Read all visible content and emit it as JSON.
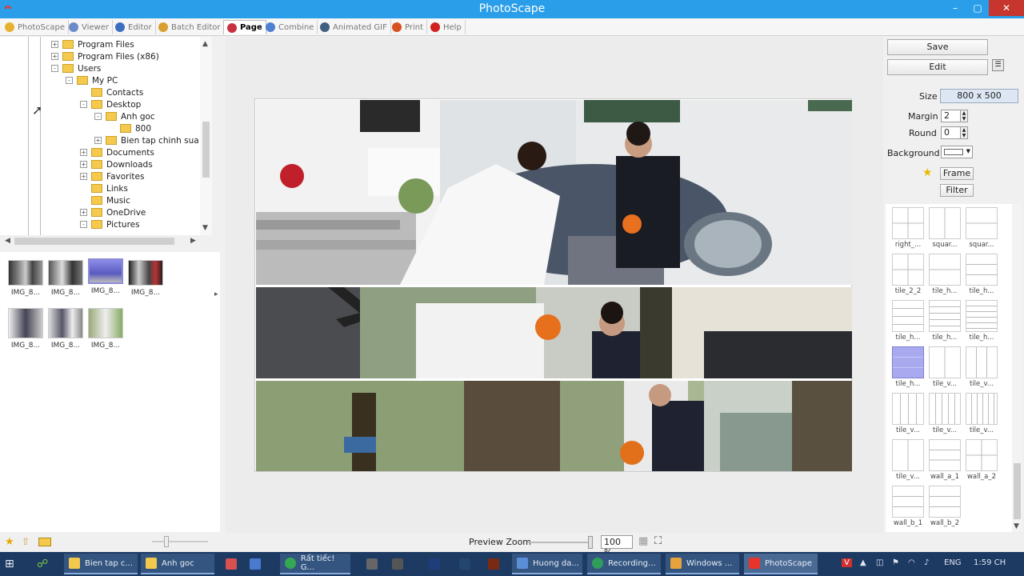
{
  "window": {
    "title": "PhotoScape",
    "minimize": "–",
    "maximize": "▢",
    "close": "✕"
  },
  "tabs": [
    {
      "label": "PhotoScape",
      "color": "#e8b030"
    },
    {
      "label": "Viewer",
      "color": "#6b8cc8"
    },
    {
      "label": "Editor",
      "color": "#3d6fc0"
    },
    {
      "label": "Batch Editor",
      "color": "#d8a030"
    },
    {
      "label": "Page",
      "color": "#c83040"
    },
    {
      "label": "Combine",
      "color": "#5080d0"
    },
    {
      "label": "Animated GIF",
      "color": "#406080"
    },
    {
      "label": "Print",
      "color": "#d85020"
    },
    {
      "label": "Help",
      "color": "#d02020"
    }
  ],
  "active_tab": "Page",
  "tree": {
    "items": [
      {
        "label": "Program Files",
        "sign": "+"
      },
      {
        "label": "Program Files (x86)",
        "sign": "+"
      },
      {
        "label": "Users",
        "sign": "-"
      },
      {
        "label": "My PC",
        "sign": "-"
      },
      {
        "label": "Contacts",
        "sign": ""
      },
      {
        "label": "Desktop",
        "sign": "-"
      },
      {
        "label": "Anh goc",
        "sign": "-"
      },
      {
        "label": "800",
        "sign": ""
      },
      {
        "label": "Bien tap chinh sua",
        "sign": "+"
      },
      {
        "label": "Documents",
        "sign": "+"
      },
      {
        "label": "Downloads",
        "sign": "+"
      },
      {
        "label": "Favorites",
        "sign": "+"
      },
      {
        "label": "Links",
        "sign": ""
      },
      {
        "label": "Music",
        "sign": ""
      },
      {
        "label": "OneDrive",
        "sign": "+"
      },
      {
        "label": "Pictures",
        "sign": "-"
      }
    ]
  },
  "thumbnails": [
    {
      "label": "IMG_8..."
    },
    {
      "label": "IMG_8..."
    },
    {
      "label": "IMG_8..."
    },
    {
      "label": "IMG_8..."
    },
    {
      "label": "IMG_8..."
    },
    {
      "label": "IMG_8..."
    },
    {
      "label": "IMG_8..."
    }
  ],
  "right": {
    "save_label": "Save",
    "edit_label": "Edit",
    "size_label": "Size",
    "size_value": "800 x 500",
    "margin_label": "Margin",
    "margin_value": "2",
    "round_label": "Round",
    "round_value": "0",
    "background_label": "Background",
    "frame_label": "Frame",
    "filter_label": "Filter"
  },
  "layouts": [
    {
      "label": "right_..."
    },
    {
      "label": "squar..."
    },
    {
      "label": "squar..."
    },
    {
      "label": "tile_2_2"
    },
    {
      "label": "tile_h..."
    },
    {
      "label": "tile_h..."
    },
    {
      "label": "tile_h..."
    },
    {
      "label": "tile_h..."
    },
    {
      "label": "tile_h..."
    },
    {
      "label": "tile_h..."
    },
    {
      "label": "tile_v..."
    },
    {
      "label": "tile_v..."
    },
    {
      "label": "tile_v..."
    },
    {
      "label": "tile_v..."
    },
    {
      "label": "tile_v..."
    },
    {
      "label": "tile_v..."
    },
    {
      "label": "wall_a_1"
    },
    {
      "label": "wall_a_2"
    },
    {
      "label": "wall_b_1"
    },
    {
      "label": "wall_b_2"
    }
  ],
  "selected_layout_index": 9,
  "zoom": {
    "label": "Preview Zoom",
    "value": "100 %"
  },
  "taskbar": {
    "items": [
      {
        "label": "Bien tap c...",
        "color": "#f2c94c"
      },
      {
        "label": "Anh goc",
        "color": "#f2c94c"
      },
      {
        "label": "Rất tiếc! G...",
        "color": "#34a853"
      },
      {
        "label": "Huong da...",
        "color": "#5a8fd8"
      },
      {
        "label": "Recording...",
        "color": "#2f9e5a"
      },
      {
        "label": "Windows ...",
        "color": "#e6a23c"
      },
      {
        "label": "PhotoScape",
        "color": "#e8352b"
      }
    ],
    "lang": "ENG",
    "time": "1:59 CH"
  }
}
